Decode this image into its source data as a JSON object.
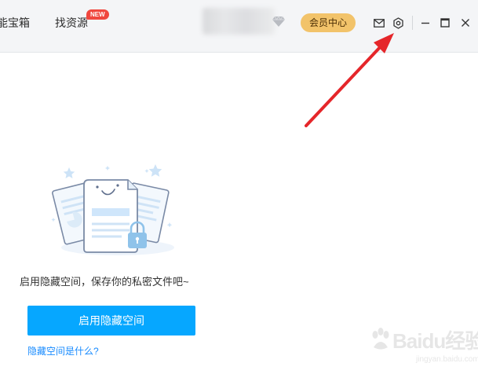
{
  "topbar": {
    "nav_cut_label": "能宝箱",
    "nav_find_label": "找资源",
    "new_badge": "NEW",
    "vip_button_label": "会员中心"
  },
  "main": {
    "hint_text": "启用隐藏空间，保存你的私密文件吧~",
    "enable_button_label": "启用隐藏空间",
    "what_link_label": "隐藏空间是什么?"
  },
  "icons": {
    "mail": "mail-icon",
    "settings": "settings-icon",
    "minimize": "minimize-icon",
    "maximize": "maximize-icon",
    "close": "close-icon",
    "vip": "diamond-icon"
  },
  "colors": {
    "accent": "#06a7ff",
    "vip_gold": "#f2c36a",
    "link": "#1a8cff",
    "badge_red": "#f0473e",
    "annotation_red": "#e5262a"
  },
  "watermark": {
    "main": "Baidu经验",
    "sub": "jingyan.baidu.com"
  }
}
